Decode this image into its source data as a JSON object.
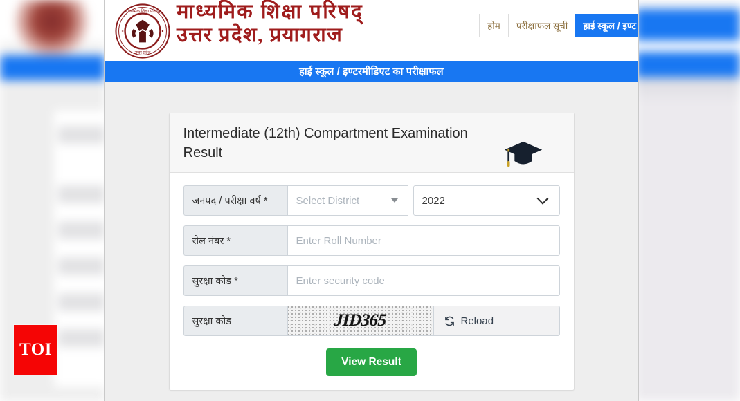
{
  "watermark": {
    "text": "TOI"
  },
  "header": {
    "logo_alt": "up-board-emblem",
    "title_line1": "माध्यमिक  शिक्षा  परिषद्",
    "title_line2": "उत्तर प्रदेश,  प्रयागराज",
    "nav": [
      {
        "label": "होम",
        "active": false
      },
      {
        "label": "परीक्षाफल सूची",
        "active": false
      },
      {
        "label": "हाई स्कूल / इण्ट",
        "active": true
      }
    ]
  },
  "banner": {
    "text": "हाई स्कूल / इण्टरमीडिएट का परीक्षाफल"
  },
  "card": {
    "title": "Intermediate (12th) Compartment Examination Result",
    "icon": "graduation-cap-icon"
  },
  "form": {
    "district_row": {
      "label": "जनपद / परीक्षा वर्ष *",
      "district_placeholder": "Select District",
      "year_value": "2022"
    },
    "roll_row": {
      "label": "रोल नंबर *",
      "placeholder": "Enter Roll Number",
      "value": ""
    },
    "security_row": {
      "label": "सुरक्षा कोड *",
      "placeholder": "Enter security code",
      "value": ""
    },
    "captcha_row": {
      "label": "सुरक्षा कोड",
      "captcha_text": "JID365",
      "reload_label": "Reload",
      "reload_icon": "refresh-icon"
    },
    "submit": {
      "label": "View Result"
    }
  },
  "colors": {
    "brand_red": "#9f1c1c",
    "banner_blue": "#1877f2",
    "submit_green": "#28a745",
    "watermark_red": "#f50505",
    "addon_grey": "#e9ecef"
  }
}
